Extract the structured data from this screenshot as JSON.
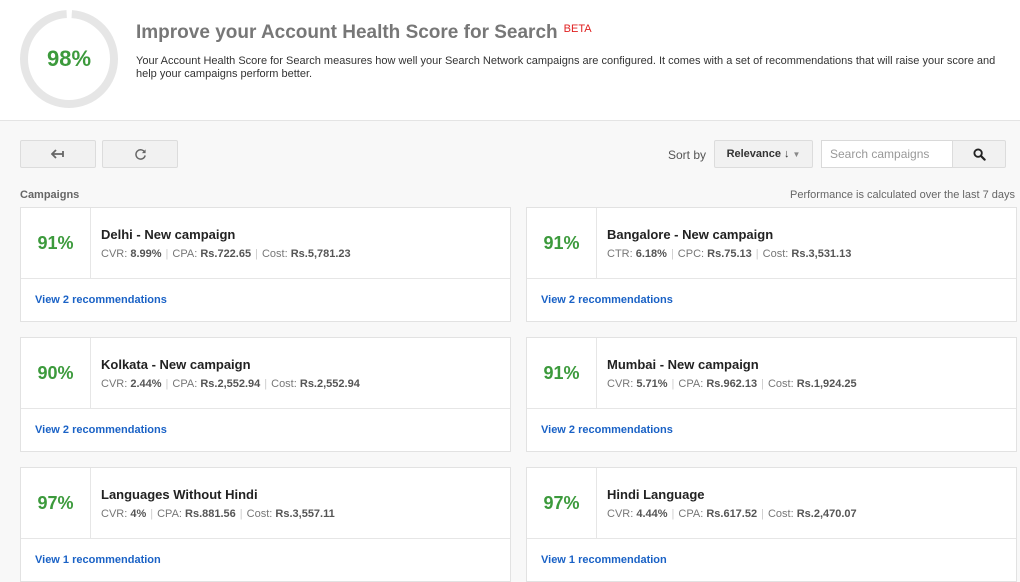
{
  "header": {
    "overall_score": "98%",
    "overall_score_fraction": 0.98,
    "title": "Improve your Account Health Score for Search",
    "beta_badge": "BETA",
    "description": "Your Account Health Score for Search measures how well your Search Network campaigns are configured. It comes with a set of recommendations that will raise your score and help your campaigns perform better.",
    "colors": {
      "score_green": "#3c9a3c",
      "ring_gray": "#e6e6e6",
      "beta_red": "#e02020"
    }
  },
  "toolbar": {
    "back_icon": "back-arrow-icon",
    "refresh_icon": "refresh-icon",
    "sort_label": "Sort by",
    "sort_value": "Relevance",
    "sort_direction_icon": "↓",
    "sort_caret": "▼",
    "search_placeholder": "Search campaigns",
    "search_value": "",
    "search_icon": "search-icon"
  },
  "section": {
    "label": "Campaigns",
    "performance_note": "Performance is calculated over the last 7 days"
  },
  "campaigns": [
    {
      "score": "91%",
      "name": "Delhi - New campaign",
      "metrics": [
        {
          "label": "CVR:",
          "value": "8.99%"
        },
        {
          "label": "CPA:",
          "value": "Rs.722.65"
        },
        {
          "label": "Cost:",
          "value": "Rs.5,781.23"
        }
      ],
      "link": "View 2 recommendations"
    },
    {
      "score": "91%",
      "name": "Bangalore - New campaign",
      "metrics": [
        {
          "label": "CTR:",
          "value": "6.18%"
        },
        {
          "label": "CPC:",
          "value": "Rs.75.13"
        },
        {
          "label": "Cost:",
          "value": "Rs.3,531.13"
        }
      ],
      "link": "View 2 recommendations"
    },
    {
      "score": "90%",
      "name": "Kolkata - New campaign",
      "metrics": [
        {
          "label": "CVR:",
          "value": "2.44%"
        },
        {
          "label": "CPA:",
          "value": "Rs.2,552.94"
        },
        {
          "label": "Cost:",
          "value": "Rs.2,552.94"
        }
      ],
      "link": "View 2 recommendations"
    },
    {
      "score": "91%",
      "name": "Mumbai - New campaign",
      "metrics": [
        {
          "label": "CVR:",
          "value": "5.71%"
        },
        {
          "label": "CPA:",
          "value": "Rs.962.13"
        },
        {
          "label": "Cost:",
          "value": "Rs.1,924.25"
        }
      ],
      "link": "View 2 recommendations"
    },
    {
      "score": "97%",
      "name": "Languages Without Hindi",
      "metrics": [
        {
          "label": "CVR:",
          "value": "4%"
        },
        {
          "label": "CPA:",
          "value": "Rs.881.56"
        },
        {
          "label": "Cost:",
          "value": "Rs.3,557.11"
        }
      ],
      "link": "View 1 recommendation"
    },
    {
      "score": "97%",
      "name": "Hindi Language",
      "metrics": [
        {
          "label": "CVR:",
          "value": "4.44%"
        },
        {
          "label": "CPA:",
          "value": "Rs.617.52"
        },
        {
          "label": "Cost:",
          "value": "Rs.2,470.07"
        }
      ],
      "link": "View 1 recommendation"
    }
  ]
}
